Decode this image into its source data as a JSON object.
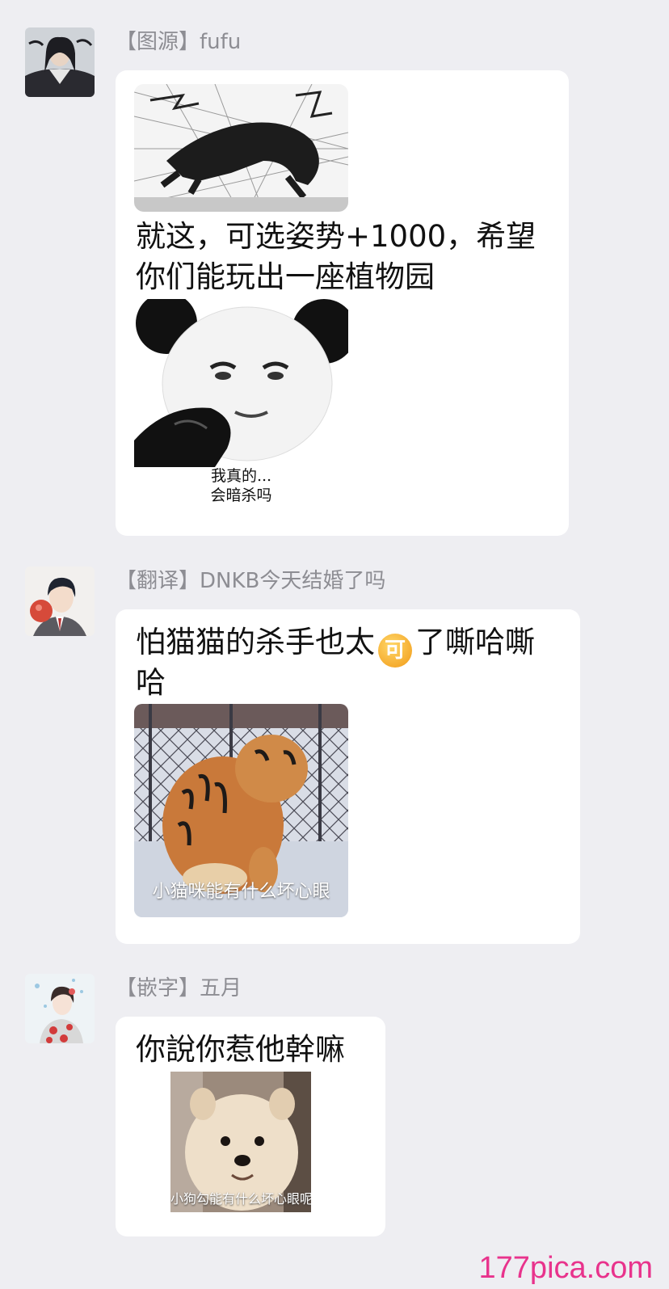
{
  "messages": [
    {
      "sender": "【图源】fufu",
      "text_line1": "就这，可选姿势+1000，希望",
      "text_line2": "你们能玩出一座植物园",
      "sticker_caption_line1": "我真的...",
      "sticker_caption_line2": "会暗杀吗"
    },
    {
      "sender": "【翻译】DNKB今天结婚了吗",
      "text_before_emoji": "怕猫猫的杀手也太",
      "emoji_label": "可",
      "text_after_emoji": "了嘶哈嘶",
      "text_line2": "哈",
      "sticker_caption": "小猫咪能有什么坏心眼"
    },
    {
      "sender": "【嵌字】五月",
      "text": "你說你惹他幹嘛",
      "sticker_caption": "小狗勾能有什么坏心眼呢"
    }
  ],
  "watermark": "177pica.com",
  "icons": [
    "avatar-dark-hair-man",
    "avatar-suit-man",
    "avatar-girl-kimono",
    "emoji-ke-icon"
  ],
  "colors": {
    "background": "#eeeef2",
    "bubble": "#ffffff",
    "sender": "#8d8d93",
    "watermark": "#e8338c",
    "emoji": "#f19a16"
  }
}
